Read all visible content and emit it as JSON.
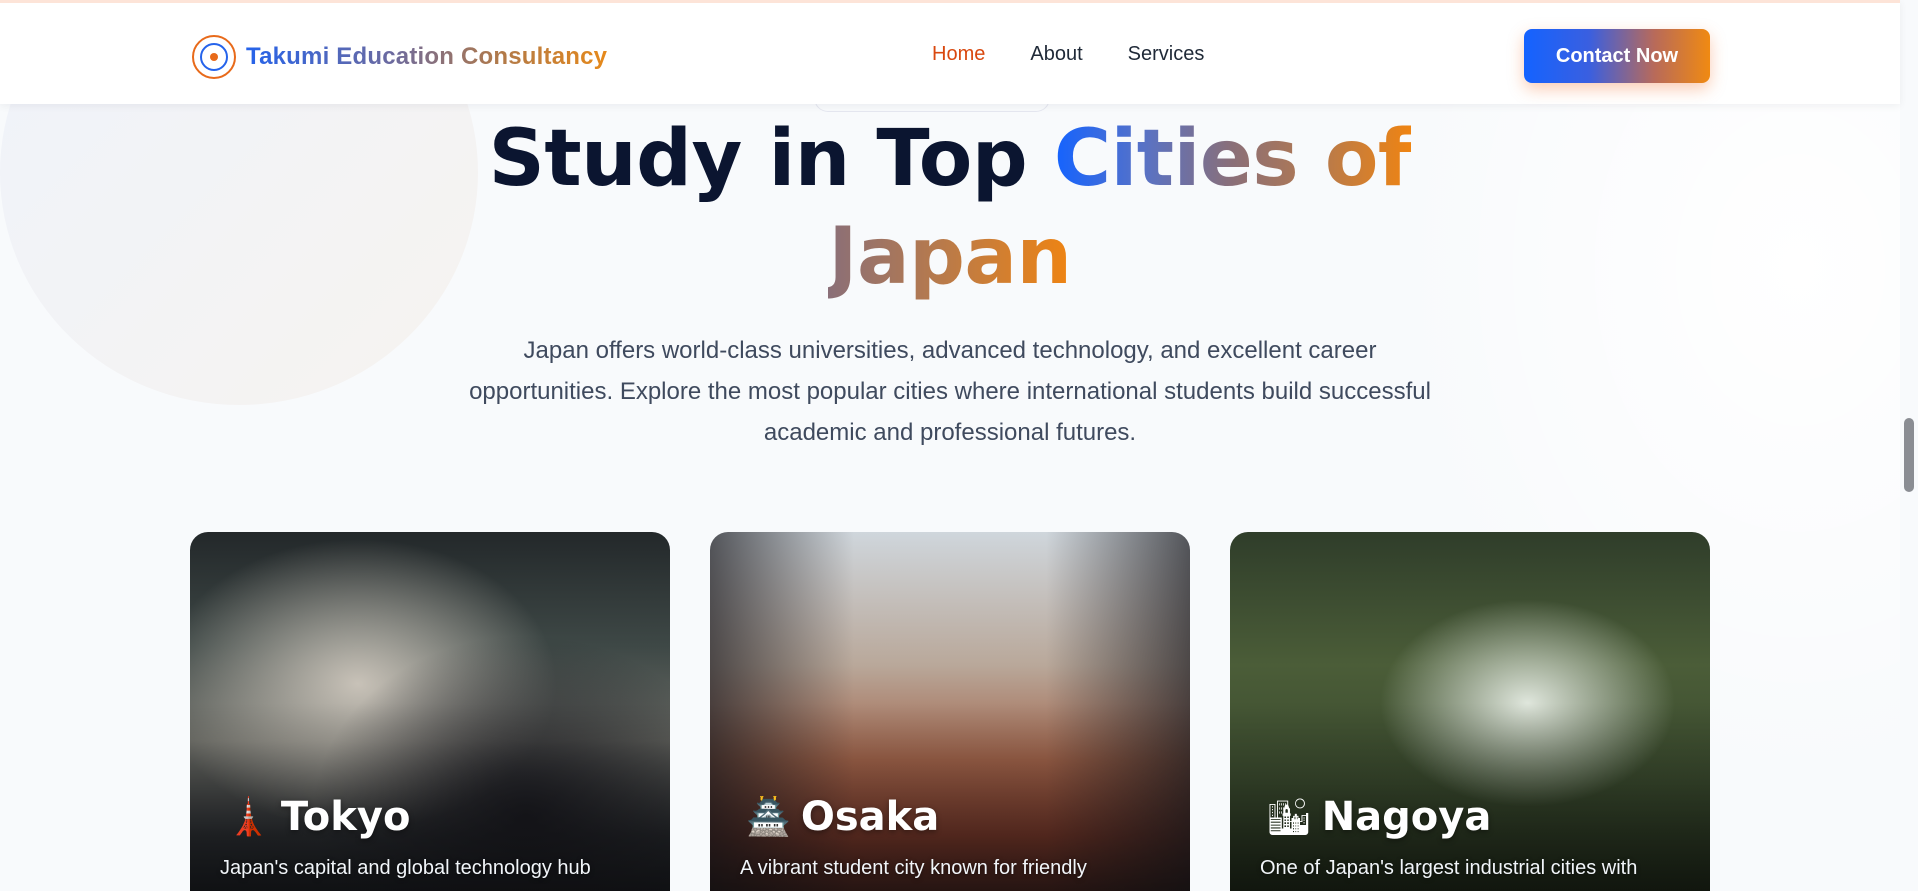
{
  "header": {
    "brand_name": "Takumi Education Consultancy",
    "logo_icon": "takumi-logo-emblem",
    "nav": [
      {
        "label": "Home",
        "active": true
      },
      {
        "label": "About",
        "active": false
      },
      {
        "label": "Services",
        "active": false
      }
    ],
    "contact_label": "Contact Now"
  },
  "hero": {
    "title_part1": "Study in Top ",
    "title_part2": "Cities of",
    "title_part3": "Japan",
    "description": "Japan offers world-class universities, advanced technology, and excellent career opportunities. Explore the most popular cities where international students build successful academic and professional futures."
  },
  "cities": [
    {
      "icon": "tokyo-tower-icon",
      "glyph": "🗼",
      "name": "Tokyo",
      "description": "Japan's capital and global technology hub"
    },
    {
      "icon": "osaka-castle-icon",
      "glyph": "🏯",
      "name": "Osaka",
      "description": "A vibrant student city known for friendly"
    },
    {
      "icon": "city-buildings-icon",
      "glyph": "🏙",
      "name": "Nagoya",
      "description": "One of Japan's largest industrial cities with"
    }
  ],
  "colors": {
    "accent_blue": "#1463ff",
    "accent_orange": "#ef8412",
    "nav_active": "#d9480f",
    "title_dark": "#0b1530"
  }
}
